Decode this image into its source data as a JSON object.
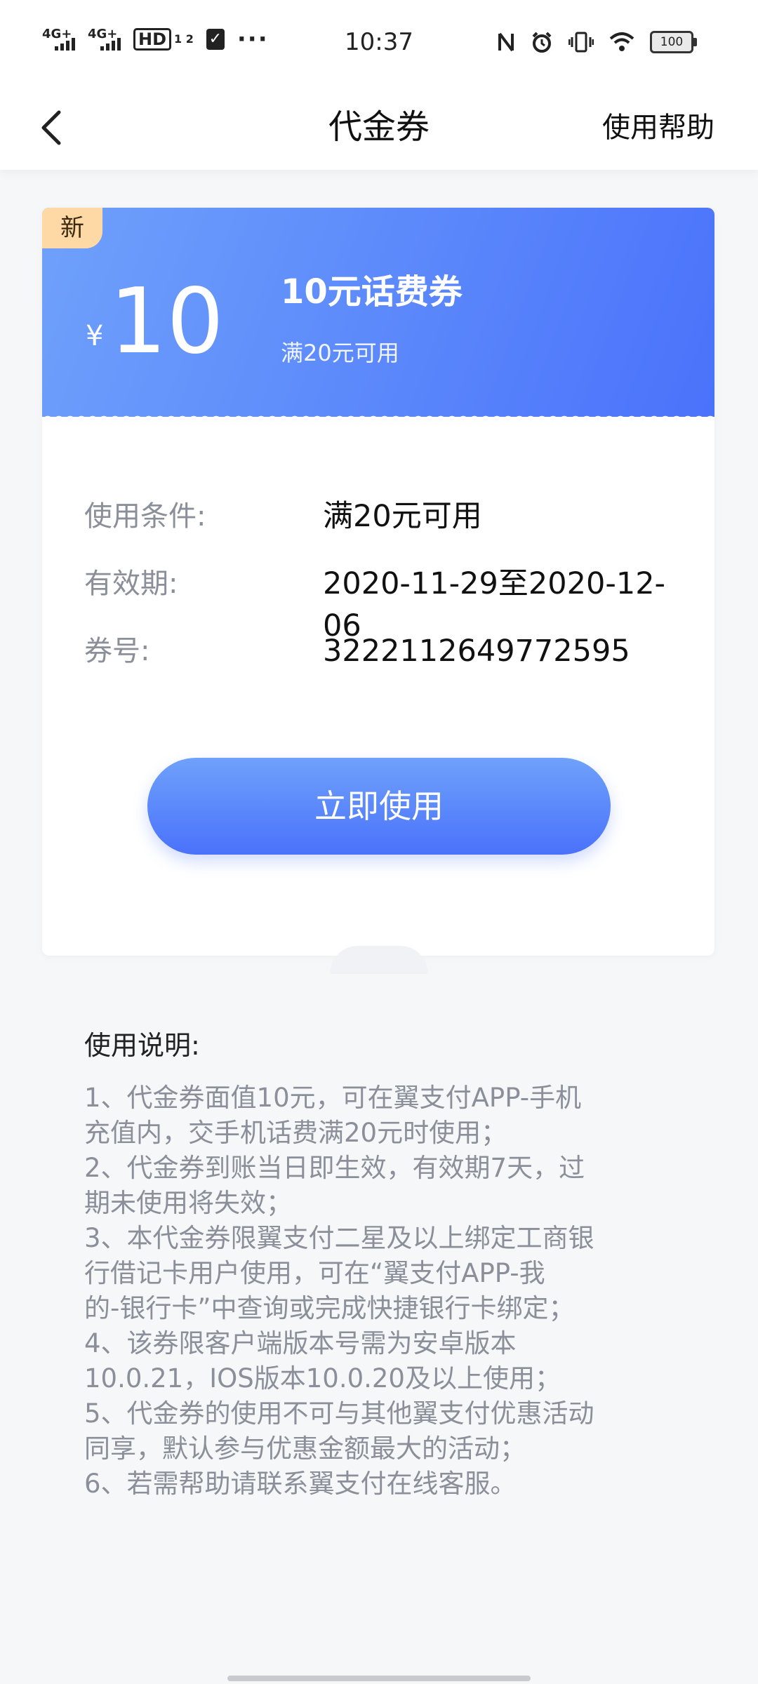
{
  "status_bar": {
    "signal_1": "4G+",
    "signal_2": "4G+",
    "hd_label": "HD",
    "hd_sub": "1 2",
    "more": "···",
    "time": "10:37",
    "battery": "100"
  },
  "nav": {
    "title": "代金券",
    "help": "使用帮助"
  },
  "coupon": {
    "badge": "新",
    "currency": "¥",
    "amount": "10",
    "name": "10元话费券",
    "condition": "满20元可用"
  },
  "details": [
    {
      "label": "使用条件:",
      "value": "满20元可用"
    },
    {
      "label": "有效期:",
      "value": "2020-11-29至2020-12-06"
    },
    {
      "label": "券号:",
      "value": "3222112649772595"
    }
  ],
  "use_button": "立即使用",
  "instructions": {
    "title": "使用说明:",
    "text": "1、代金券面值10元，可在翼支付APP-手机\n充值内，交手机话费满20元时使用；\n2、代金券到账当日即生效，有效期7天，过\n期未使用将失效；\n3、本代金券限翼支付二星及以上绑定工商银\n行借记卡用户使用，可在“翼支付APP-我\n的-银行卡”中查询或完成快捷银行卡绑定；\n4、该券限客户端版本号需为安卓版本\n10.0.21，IOS版本10.0.20及以上使用；\n5、代金券的使用不可与其他翼支付优惠活动\n同享，默认参与优惠金额最大的活动；\n6、若需帮助请联系翼支付在线客服。"
  },
  "colors": {
    "accent_start": "#6fa1fb",
    "accent_end": "#4a72fb",
    "badge": "#ffd9a5",
    "label_gray": "#8a8f99"
  }
}
